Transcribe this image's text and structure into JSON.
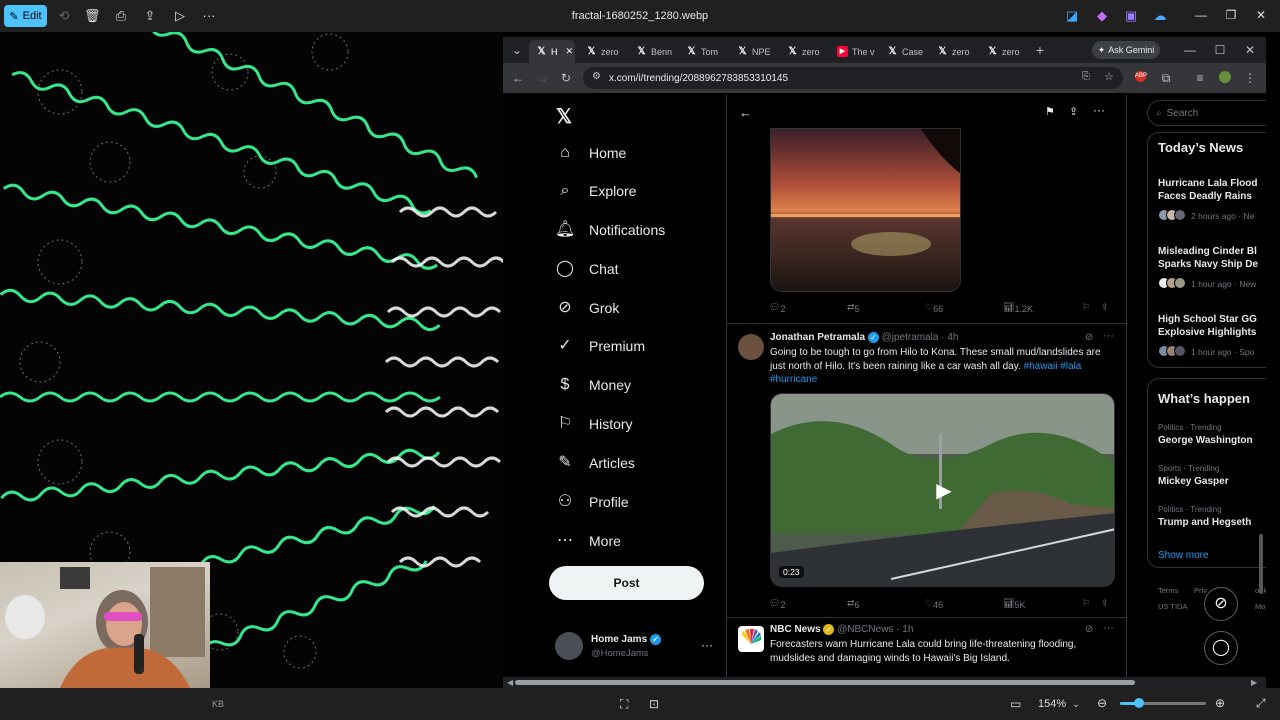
{
  "viewer": {
    "edit_label": "Edit",
    "file_title": "fractal-1680252_1280.webp",
    "status_kb": "KB",
    "zoom": "154%"
  },
  "chrome": {
    "tabs": [
      {
        "label": "H",
        "icon": "x-logo",
        "active": true
      },
      {
        "label": "zero",
        "icon": "x-logo"
      },
      {
        "label": "Benn",
        "icon": "x-logo"
      },
      {
        "label": "Tom",
        "icon": "x-logo"
      },
      {
        "label": "NPE",
        "icon": "x-logo"
      },
      {
        "label": "zero",
        "icon": "x-logo"
      },
      {
        "label": "The v",
        "icon": "youtube-logo"
      },
      {
        "label": "Case",
        "icon": "x-logo"
      },
      {
        "label": "zero",
        "icon": "x-logo"
      },
      {
        "label": "zero",
        "icon": "x-logo"
      }
    ],
    "ask_gemini": "Ask Gemini",
    "url": "x.com/i/trending/2088962783853310145"
  },
  "x": {
    "nav": [
      {
        "label": "Home",
        "icon": "home-icon"
      },
      {
        "label": "Explore",
        "icon": "search-icon"
      },
      {
        "label": "Notifications",
        "icon": "bell-icon"
      },
      {
        "label": "Chat",
        "icon": "chat-icon"
      },
      {
        "label": "Grok",
        "icon": "grok-icon"
      },
      {
        "label": "Premium",
        "icon": "premium-icon"
      },
      {
        "label": "Money",
        "icon": "money-icon"
      },
      {
        "label": "History",
        "icon": "bookmark-icon"
      },
      {
        "label": "Articles",
        "icon": "articles-icon"
      },
      {
        "label": "Profile",
        "icon": "profile-icon"
      },
      {
        "label": "More",
        "icon": "more-icon"
      }
    ],
    "post_label": "Post",
    "account": {
      "name": "Home Jams",
      "handle": "@HomeJams"
    },
    "tweet1_stats": {
      "replies": "2",
      "reposts": "5",
      "likes": "66",
      "views": "1.2K"
    },
    "tweet2": {
      "name": "Jonathan Petramala",
      "handle": "@jpetramala",
      "time": "· 4h",
      "text": "Going to be tough to go from Hilo to Kona. These small mud/landslides are just north of Hilo. It's been raining like a car wash all day.",
      "hashtags": "#hawaii #lala #hurricane",
      "video_duration": "0:23",
      "stats": {
        "replies": "2",
        "reposts": "6",
        "likes": "46",
        "views": "5K"
      }
    },
    "tweet3": {
      "name": "NBC News",
      "handle": "@NBCNews",
      "time": "· 1h",
      "text": "Forecasters warn Hurricane Lala could bring life-threatening flooding, mudslides and damaging winds to Hawaii's Big Island."
    },
    "search_placeholder": "Search",
    "todays_news": {
      "heading": "Today’s News",
      "items": [
        {
          "title1": "Hurricane Lala Flood",
          "title2": "Faces Deadly Rains",
          "meta": "2 hours ago · Ne"
        },
        {
          "title1": "Misleading Cinder Bl",
          "title2": "Sparks Navy Ship De",
          "meta": "1 hour ago · New"
        },
        {
          "title1": "High School Star GG",
          "title2": "Explosive Highlights",
          "meta": "1 hour ago · Spo"
        }
      ]
    },
    "whats_happening": {
      "heading": "What’s happen",
      "trends": [
        {
          "category": "Politics · Trending",
          "name": "George Washington"
        },
        {
          "category": "Sports · Trending",
          "name": "Mickey Gasper"
        },
        {
          "category": "Politics · Trending",
          "name": "Trump and Hegseth"
        }
      ],
      "show_more": "Show more"
    },
    "footer": {
      "terms": "Terms",
      "privacy": "Priv",
      "cookie": "ookie",
      "us_tida": "US TIDA",
      "more": "Mo"
    }
  }
}
